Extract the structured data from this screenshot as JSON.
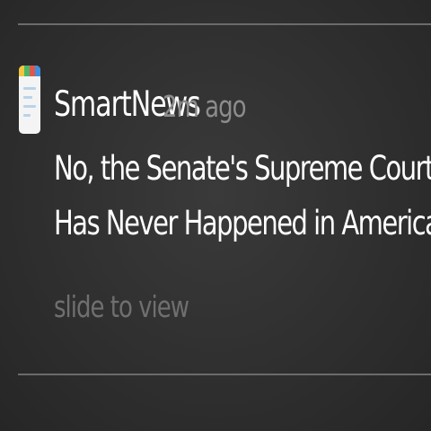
{
  "notification": {
    "app_name": "SmartNews",
    "time_ago": "2m ago",
    "icon": "smartnews-app-icon",
    "headline_lines": [
      "No, the Senate's Supreme Court Blockade",
      "Has Never Happened in American History"
    ],
    "action_hint": "slide to view"
  },
  "colors": {
    "background": "#2e2e2e",
    "title_text": "#ffffff",
    "secondary_text": "#8c8c8c",
    "hint_text": "#6f6f6f",
    "divider": "#6b6b6b",
    "icon_yellow": "#f2c53d",
    "icon_green": "#4fb56a",
    "icon_red": "#e2564a",
    "icon_blue": "#3f8fe0"
  }
}
